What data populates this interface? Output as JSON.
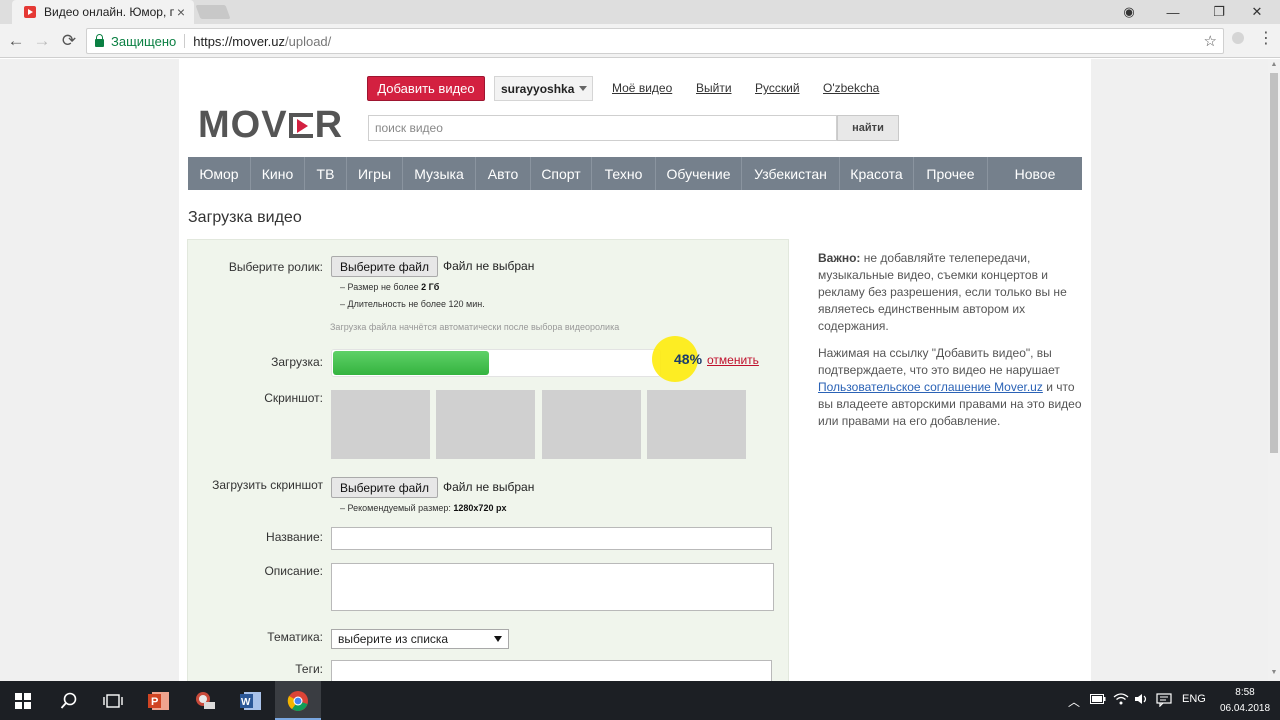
{
  "browser": {
    "tab_title": "Видео онлайн. Юмор, п",
    "tab_close": "×",
    "secure_label": "Защищено",
    "url_host": "https://mover.uz",
    "url_path": "/upload/",
    "window_controls": {
      "profile": "◉",
      "minimize": "—",
      "restore": "❐",
      "close": "✕"
    },
    "back": "←",
    "forward": "→",
    "reload": "⟳",
    "star": "☆",
    "menu": "⋮"
  },
  "header": {
    "add_video": "Добавить видео",
    "username": "surayyoshka",
    "links": [
      "Моё видео",
      "Выйти",
      "Русский",
      "O'zbekcha"
    ],
    "logo_left": "MOV",
    "logo_right": "R",
    "search_placeholder": "поиск видео",
    "search_button": "найти"
  },
  "categories": [
    "Юмор",
    "Кино",
    "ТВ",
    "Игры",
    "Музыка",
    "Авто",
    "Спорт",
    "Техно",
    "Обучение",
    "Узбекистан",
    "Красота",
    "Прочее",
    "Новое"
  ],
  "page_title": "Загрузка видео",
  "form": {
    "choose_video_label": "Выберите ролик:",
    "choose_file_button": "Выберите файл",
    "no_file_chosen": "Файл не выбран",
    "size_hint_prefix": "– Размер не более ",
    "size_hint_value": "2 Гб",
    "duration_hint": "– Длительность не более 120 мин.",
    "auto_upload_note": "Загрузка файла начнётся автоматически после выбора видеоролика",
    "upload_label": "Загрузка:",
    "upload_progress": 0.48,
    "upload_percent_text": "48%",
    "cancel_link": "отменить",
    "screenshot_label": "Скриншот:",
    "upload_screenshot_label": "Загрузить скриншот",
    "screenshot_file_button": "Выберите файл",
    "screenshot_no_file": "Файл не выбран",
    "recommended_prefix": "– Рекомендуемый размер: ",
    "recommended_value": "1280x720 px",
    "title_label": "Название:",
    "title_value": "",
    "description_label": "Описание:",
    "description_value": "",
    "topic_label": "Тематика:",
    "topic_selected": "выберите из списка",
    "tags_label": "Теги:"
  },
  "info": {
    "important_label": "Важно:",
    "important_text": " не добавляйте телепередачи, музыкальные видео, съемки концертов и рекламу без разрешения, если только вы не являетесь единственным автором их содержания.",
    "agreement_before": "Нажимая на ссылку \"Добавить видео\", вы подтверждаете, что это видео не нарушает ",
    "agreement_link": "Пользовательское соглашение Mover.uz",
    "agreement_after": " и что вы владеете авторскими правами на это видео или правами на его добавление."
  },
  "taskbar": {
    "lang": "ENG",
    "time": "8:58",
    "date": "06.04.2018"
  },
  "colors": {
    "accent_red": "#d32040",
    "nav_bg": "#75808c",
    "progress_green": "#34b33f",
    "form_bg": "#f0f5ec"
  }
}
